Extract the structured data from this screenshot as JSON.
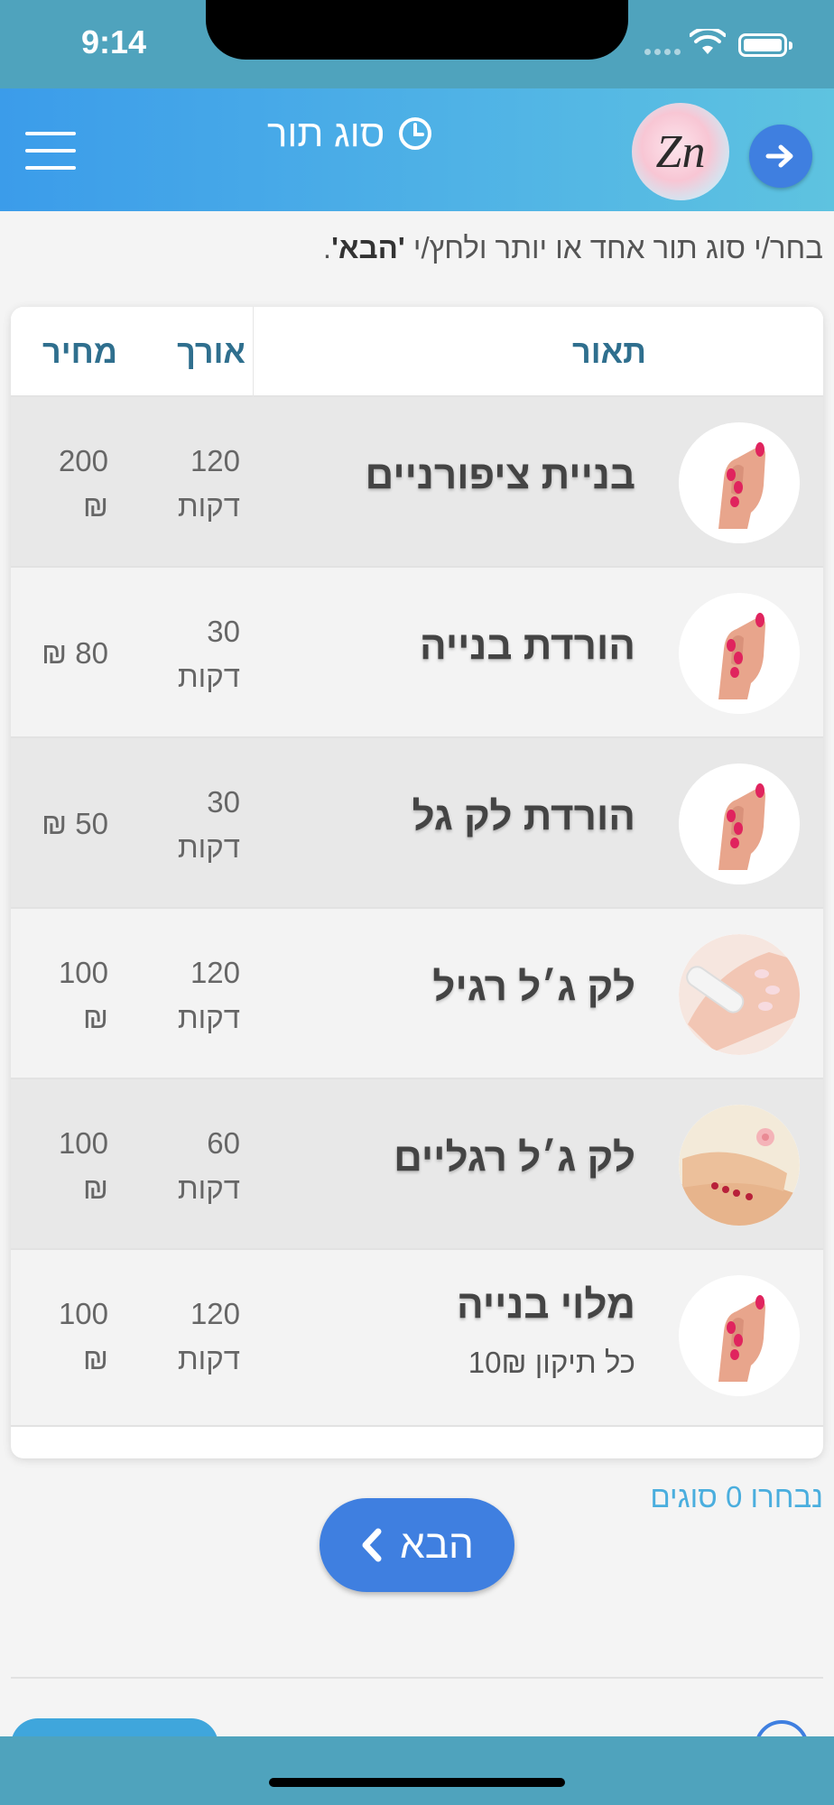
{
  "status_bar": {
    "time": "9:14"
  },
  "header": {
    "title": "סוג תור"
  },
  "logo": {
    "text": "Zn"
  },
  "instruction": {
    "prefix": "בחר/י סוג תור אחד או יותר ולחץ/י",
    "highlight": "'הבא'",
    "suffix": "."
  },
  "table": {
    "columns": {
      "description": "תאור",
      "duration": "אורך",
      "price": "מחיר"
    },
    "rows": [
      {
        "name": "בניית ציפורניים",
        "duration": "120",
        "duration_unit": "דקות",
        "price": "200",
        "currency": "₪",
        "image": "red-manicure-hand",
        "price_single_line": false
      },
      {
        "name": "הורדת בנייה",
        "duration": "30",
        "duration_unit": "דקות",
        "price": "₪ 80",
        "currency": "",
        "image": "red-manicure-hand",
        "price_single_line": true
      },
      {
        "name": "הורדת לק גל",
        "duration": "30",
        "duration_unit": "דקות",
        "price": "₪ 50",
        "currency": "",
        "image": "red-manicure-hand",
        "price_single_line": true
      },
      {
        "name": "לק ג׳ל רגיל",
        "duration": "120",
        "duration_unit": "דקות",
        "price": "100",
        "currency": "₪",
        "image": "nail-file-hand",
        "price_single_line": false
      },
      {
        "name": "לק ג׳ל רגליים",
        "duration": "60",
        "duration_unit": "דקות",
        "price": "100",
        "currency": "₪",
        "image": "pedicure-feet",
        "price_single_line": false
      },
      {
        "name": "מלוי בנייה",
        "note": "כל תיקון 10₪",
        "duration": "120",
        "duration_unit": "דקות",
        "price": "100",
        "currency": "₪",
        "image": "red-manicure-hand",
        "price_single_line": false
      }
    ]
  },
  "selection": {
    "count_text": "נבחרו 0 סוגים"
  },
  "next_button": {
    "label": "הבא"
  },
  "colors": {
    "primary_blue": "#3f7fe0",
    "header_start": "#3b9cea",
    "header_end": "#5ec3e0",
    "status_bar": "#4fa3bd",
    "column_header_text": "#2f6f8e",
    "selected_count_text": "#4aaede"
  },
  "icons": {
    "menu": "hamburger-menu-icon",
    "clock": "clock-icon",
    "forward": "arrow-right-icon",
    "next_chevron": "chevron-left-icon"
  }
}
